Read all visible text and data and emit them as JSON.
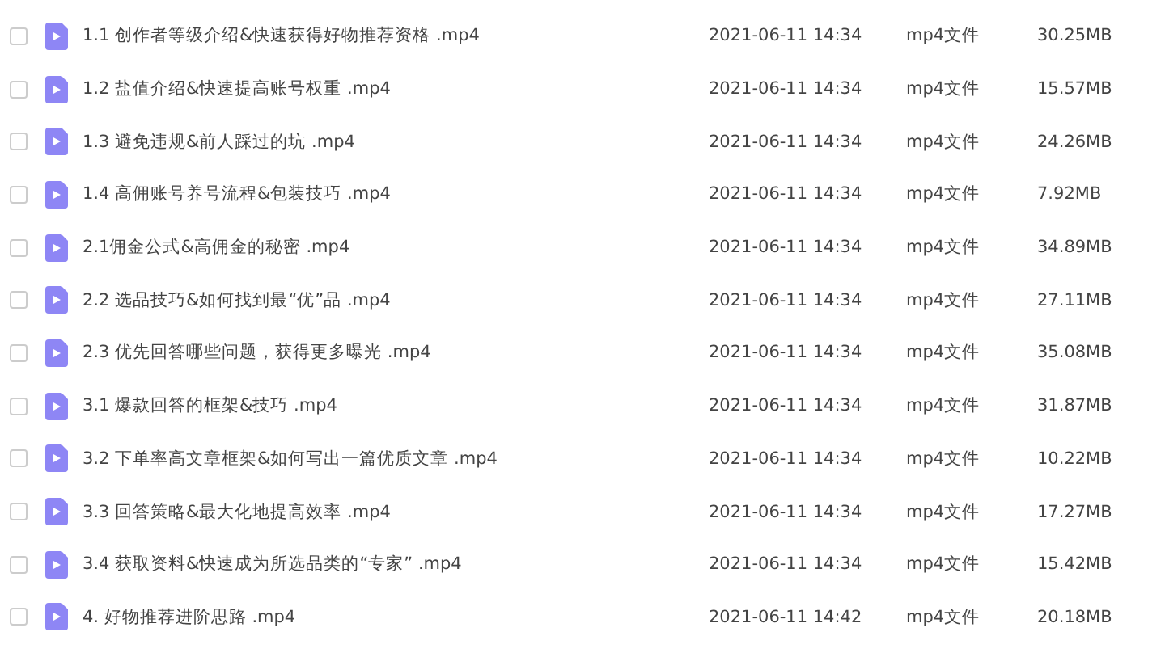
{
  "files": [
    {
      "checked": false,
      "name": "1.1 创作者等级介绍&快速获得好物推荐资格 .mp4",
      "modified": "2021-06-11 14:34",
      "type": "mp4文件",
      "size": "30.25MB"
    },
    {
      "checked": false,
      "name": "1.2 盐值介绍&快速提高账号权重 .mp4",
      "modified": "2021-06-11 14:34",
      "type": "mp4文件",
      "size": "15.57MB"
    },
    {
      "checked": false,
      "name": "1.3 避免违规&前人踩过的坑 .mp4",
      "modified": "2021-06-11 14:34",
      "type": "mp4文件",
      "size": "24.26MB"
    },
    {
      "checked": false,
      "name": "1.4 高佣账号养号流程&包装技巧 .mp4",
      "modified": "2021-06-11 14:34",
      "type": "mp4文件",
      "size": "7.92MB"
    },
    {
      "checked": false,
      "name": "2.1佣金公式&高佣金的秘密 .mp4",
      "modified": "2021-06-11 14:34",
      "type": "mp4文件",
      "size": "34.89MB"
    },
    {
      "checked": false,
      "name": "2.2 选品技巧&如何找到最“优”品 .mp4",
      "modified": "2021-06-11 14:34",
      "type": "mp4文件",
      "size": "27.11MB"
    },
    {
      "checked": false,
      "name": "2.3 优先回答哪些问题，获得更多曝光 .mp4",
      "modified": "2021-06-11 14:34",
      "type": "mp4文件",
      "size": "35.08MB"
    },
    {
      "checked": false,
      "name": "3.1 爆款回答的框架&技巧 .mp4",
      "modified": "2021-06-11 14:34",
      "type": "mp4文件",
      "size": "31.87MB"
    },
    {
      "checked": false,
      "name": "3.2 下单率高文章框架&如何写出一篇优质文章 .mp4",
      "modified": "2021-06-11 14:34",
      "type": "mp4文件",
      "size": "10.22MB"
    },
    {
      "checked": false,
      "name": "3.3 回答策略&最大化地提高效率 .mp4",
      "modified": "2021-06-11 14:34",
      "type": "mp4文件",
      "size": "17.27MB"
    },
    {
      "checked": false,
      "name": "3.4 获取资料&快速成为所选品类的“专家”  .mp4",
      "modified": "2021-06-11 14:34",
      "type": "mp4文件",
      "size": "15.42MB"
    },
    {
      "checked": false,
      "name": "4. 好物推荐进阶思路 .mp4",
      "modified": "2021-06-11 14:42",
      "type": "mp4文件",
      "size": "20.18MB"
    }
  ]
}
